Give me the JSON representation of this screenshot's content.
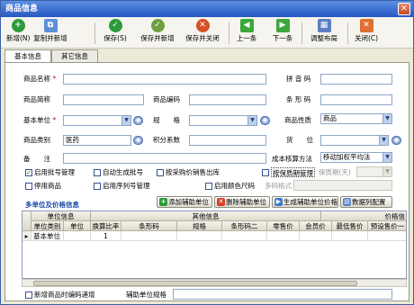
{
  "window": {
    "title": "商品信息"
  },
  "toolbar": {
    "add": "新增(N)",
    "copy_add": "复制并新增",
    "save": "保存(S)",
    "save_add": "保存并新增",
    "save_close": "保存并关闭",
    "prev": "上一条",
    "next": "下一条",
    "layout": "调整布局",
    "close": "关闭(C)"
  },
  "tabs": [
    "基本信息",
    "其它信息"
  ],
  "form": {
    "name_label": "商品名称",
    "pinyin_label": "拼 音 码",
    "alias_label": "商品简称",
    "code_label": "商品编码",
    "barcode_label": "条 形 码",
    "unit_label": "基本单位",
    "spec_label": "规　　格",
    "nature_label": "商品性质",
    "nature_value": "商品",
    "category_label": "商品类别",
    "category_value": "医药",
    "points_label": "积分系数",
    "shelf_label": "货　　位",
    "remark_label": "备　　注",
    "cost_label": "成本核算方法",
    "cost_value": "移动加权平均法",
    "batch_label": "启用批号管理",
    "auto_batch_label": "自动生成批号",
    "price_out_label": "按采购价销售出库",
    "shelf_life_label": "按保质期管理",
    "shelf_days_label": "保质期(天)",
    "disable_label": "停用商品",
    "serial_label": "启用序列号管理",
    "color_size_label": "启用颜色尺码",
    "color_size_format_label": "多码格式"
  },
  "multi_unit": {
    "title": "多单位及价格信息",
    "add_unit_btn": "添加辅助单位",
    "del_unit_btn": "删除辅助单位",
    "gen_price_btn": "生成辅助单位价格",
    "data_config_btn": "数据列配置"
  },
  "grid": {
    "group_headers": [
      "单位信息",
      "其他信息",
      "价格信"
    ],
    "columns": [
      "单位类别",
      "单位",
      "换算比率",
      "条形码",
      "规格",
      "条形码二",
      "零售价",
      "会员价",
      "最低售价",
      "预设售价一"
    ],
    "rows": [
      [
        "基本单位",
        "",
        "1",
        "",
        "",
        "",
        "",
        "",
        "",
        ""
      ]
    ]
  },
  "footer": {
    "new_code_label": "新增商品时编码递增",
    "aux_spec_label": "辅助单位规格"
  },
  "colors": {
    "accent": "#2557c4",
    "title_text": "#1a4aa8"
  }
}
